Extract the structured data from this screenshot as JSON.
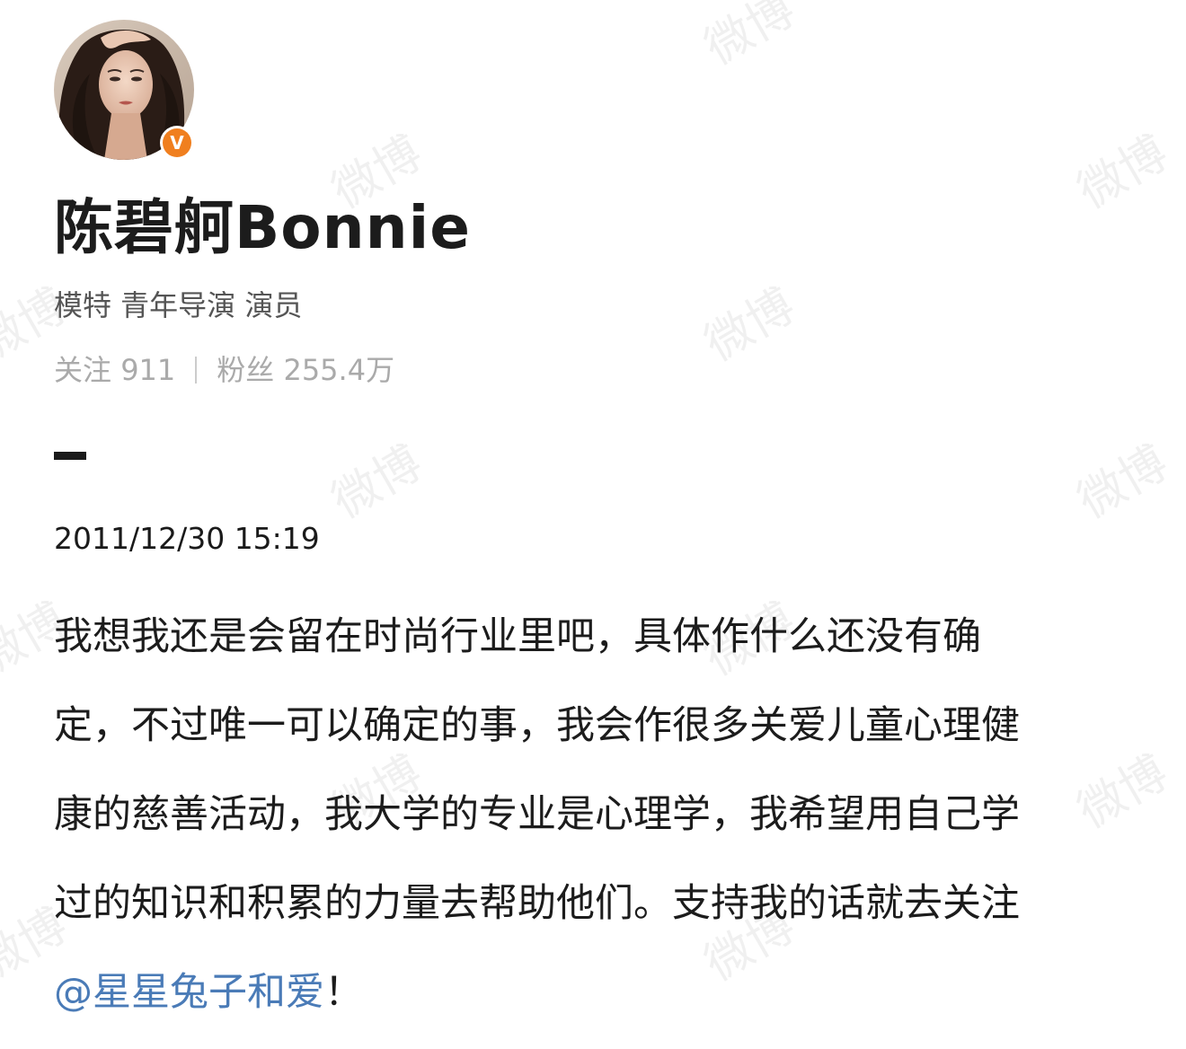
{
  "profile": {
    "name": "陈碧舸Bonnie",
    "verified_badge": "V",
    "bio": "模特 青年导演 演员",
    "following_label": "关注",
    "following_count": "911",
    "followers_label": "粉丝",
    "followers_count": "255.4万",
    "avatar": "avatar-photo"
  },
  "post": {
    "timestamp": "2011/12/30 15:19",
    "lines": [
      "我想我还是会留在时尚行业里吧，具体作什么还没有确",
      "定，不过唯一可以确定的事，我会作很多关爱儿童心理健",
      "康的慈善活动，我大学的专业是心理学，我希望用自己学",
      "过的知识和积累的力量去帮助他们。支持我的话就去关注"
    ],
    "mention": "@星星兔子和爱",
    "ending": "！"
  },
  "watermark": "微博",
  "colors": {
    "badge": "#f07f1f",
    "mention": "#4a7bb7",
    "muted": "#aaaaaa"
  }
}
